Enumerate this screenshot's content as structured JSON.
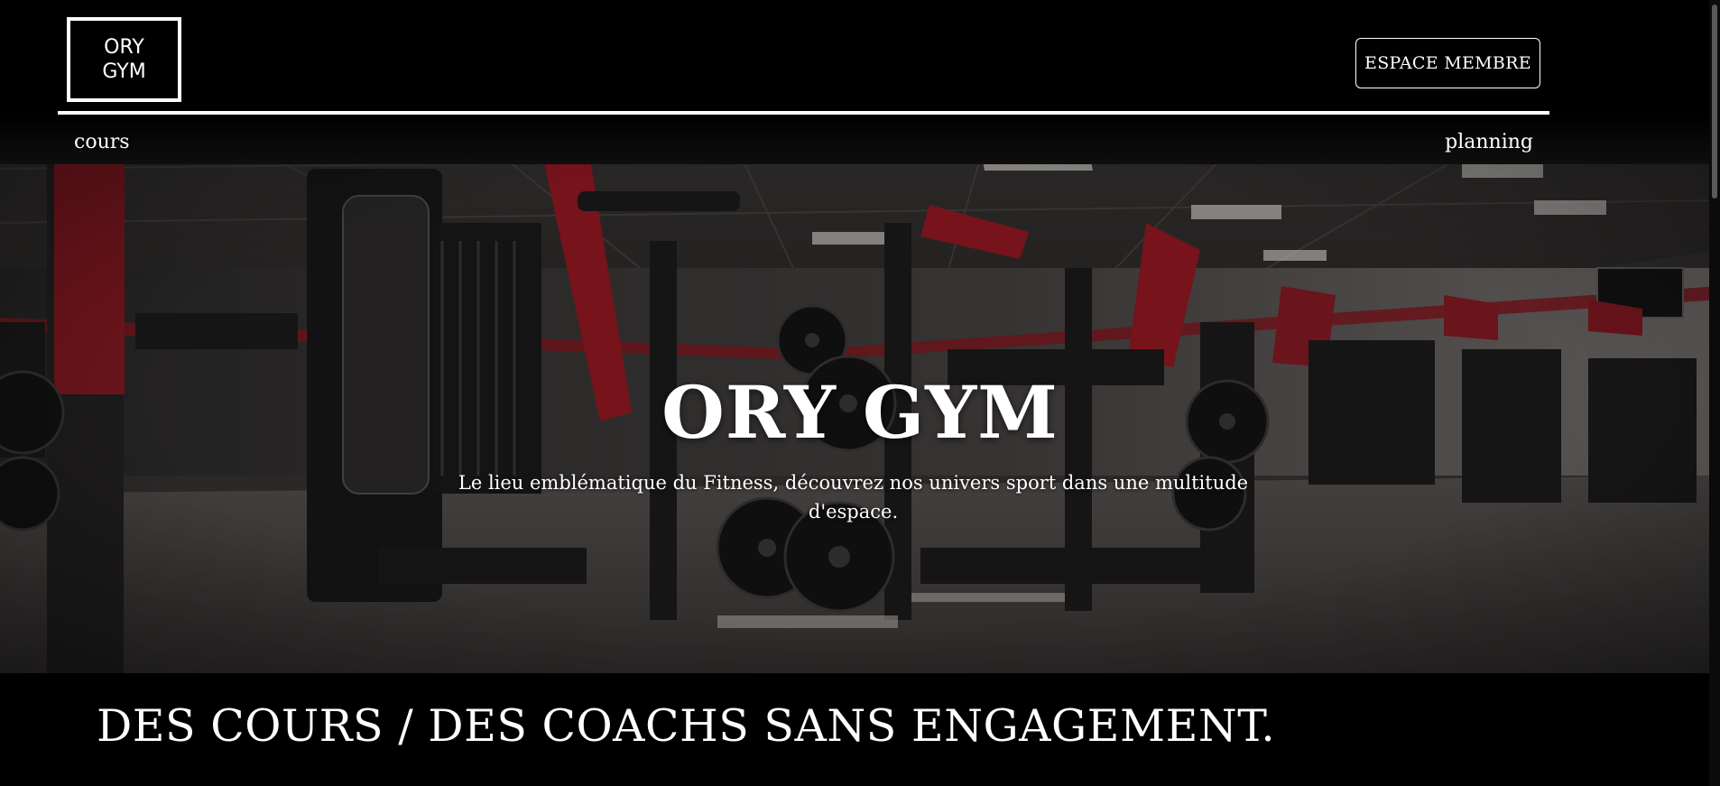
{
  "header": {
    "logo_text": "ORY GYM",
    "member_button_label": "ESPACE MEMBRE"
  },
  "nav": {
    "left_link": "cours",
    "right_link": "planning"
  },
  "hero": {
    "title": "ORY GYM",
    "subtitle": "Le lieu emblématique du Fitness, découvrez nos univers sport dans une multitude d'espace."
  },
  "section": {
    "title": "DES COURS / DES COACHS SANS ENGAGEMENT."
  },
  "colors": {
    "background": "#000000",
    "text": "#ffffff",
    "accent_red": "#a3141f"
  }
}
